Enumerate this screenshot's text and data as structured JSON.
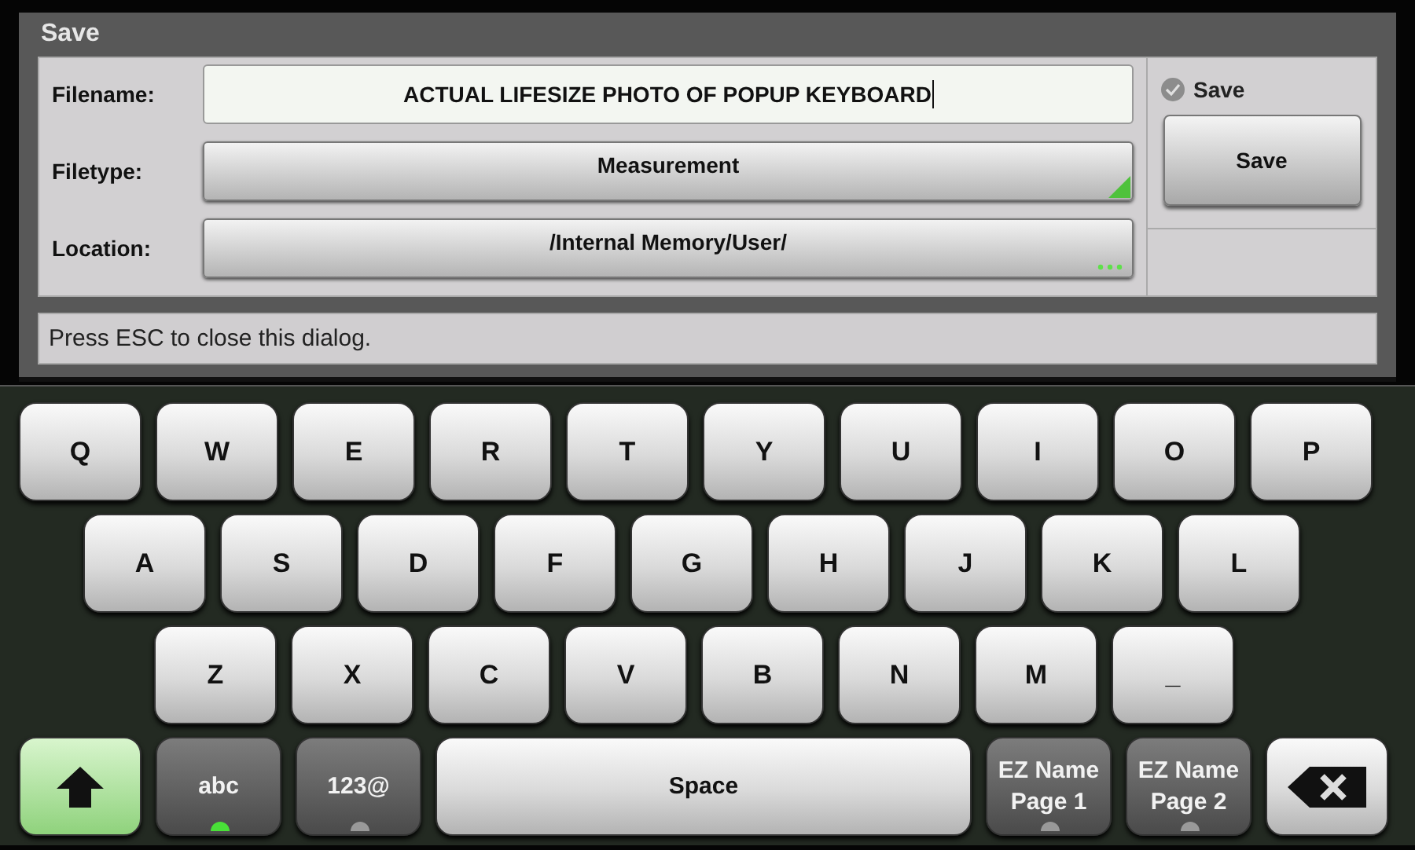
{
  "dialog": {
    "title": "Save",
    "fields": [
      {
        "kind": "text",
        "label": "Filename:",
        "value": "ACTUAL LIFESIZE PHOTO OF POPUP KEYBOARD"
      },
      {
        "kind": "dropdown",
        "label": "Filetype:",
        "value": "Measurement"
      },
      {
        "kind": "browse",
        "label": "Location:",
        "value": "/Internal Memory/User/"
      }
    ],
    "save_checkbox": {
      "label": "Save",
      "checked": true
    },
    "save_button": "Save",
    "status_text": "Press ESC to close this dialog."
  },
  "keyboard": {
    "rows": [
      [
        "Q",
        "W",
        "E",
        "R",
        "T",
        "Y",
        "U",
        "I",
        "O",
        "P"
      ],
      [
        "A",
        "S",
        "D",
        "F",
        "G",
        "H",
        "J",
        "K",
        "L"
      ],
      [
        "Z",
        "X",
        "C",
        "V",
        "B",
        "N",
        "M",
        "_"
      ]
    ],
    "bottom_row": [
      {
        "kind": "shift",
        "selected": true
      },
      {
        "kind": "mode",
        "label": "abc",
        "selected": true
      },
      {
        "kind": "mode",
        "label": "123@",
        "selected": false
      },
      {
        "kind": "space",
        "label": "Space",
        "selected": false
      },
      {
        "kind": "mode",
        "label": "EZ Name Page 1",
        "selected": false
      },
      {
        "kind": "mode",
        "label": "EZ Name Page 2",
        "selected": false
      },
      {
        "kind": "backspace",
        "selected": false
      }
    ]
  }
}
